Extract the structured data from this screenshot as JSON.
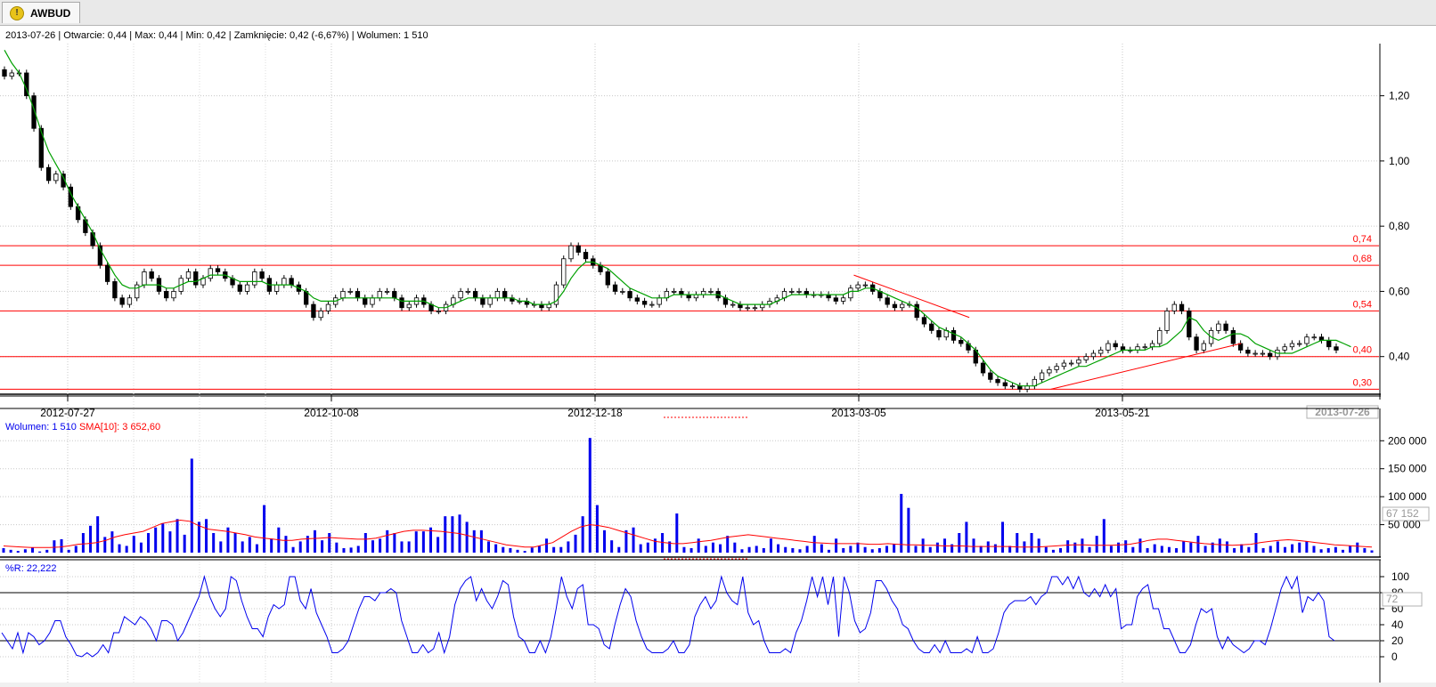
{
  "tab": {
    "label": "AWBUD",
    "icon": "warning-icon"
  },
  "header": {
    "date": "2013-07-26",
    "open": "Otwarcie: 0,44",
    "max": "Max: 0,44",
    "min": "Min: 0,42",
    "close": "Zamknięcie: 0,42 (-6,67%)",
    "volume": "Wolumen: 1 510"
  },
  "volume_legend": {
    "wolumen": "Wolumen: 1 510",
    "sma": "SMA[10]: 3 652,60"
  },
  "willr_legend": {
    "label": "%R: 22,222"
  },
  "colors": {
    "price_line": "#00a000",
    "levels": "#ff0000",
    "volume_bar": "#0000ee",
    "sma": "#ff0000",
    "willr": "#0000ee",
    "grid": "#c8c8c8"
  },
  "chart_data": [
    {
      "type": "candlestick",
      "yticks": [
        "1,20",
        "1,00",
        "0,80",
        "0,60",
        "0,40"
      ],
      "ytick_values": [
        1.2,
        1.0,
        0.8,
        0.6,
        0.4
      ],
      "xticks": [
        "2012-07-27",
        "2012-10-08",
        "2012-12-18",
        "2013-03-05",
        "2013-05-21"
      ],
      "current_date_label": "2013-07-26",
      "ylim": [
        0.29,
        1.36
      ],
      "levels": [
        {
          "label": "0,74",
          "value": 0.74
        },
        {
          "label": "0,68",
          "value": 0.68
        },
        {
          "label": "0,54",
          "value": 0.54
        },
        {
          "label": "0,40",
          "value": 0.4
        },
        {
          "label": "0,30",
          "value": 0.3
        }
      ],
      "trendlines": [
        {
          "from": [
            "2013-03-15",
            0.65
          ],
          "to": [
            "2013-04-20",
            0.52
          ]
        },
        {
          "from": [
            "2013-05-08",
            0.3
          ],
          "to": [
            "2013-06-27",
            0.44
          ]
        }
      ],
      "close_series": [
        1.26,
        1.27,
        1.27,
        1.2,
        1.1,
        0.98,
        0.94,
        0.96,
        0.92,
        0.86,
        0.82,
        0.78,
        0.74,
        0.68,
        0.63,
        0.58,
        0.56,
        0.58,
        0.62,
        0.66,
        0.64,
        0.6,
        0.58,
        0.6,
        0.64,
        0.66,
        0.62,
        0.64,
        0.67,
        0.66,
        0.64,
        0.62,
        0.6,
        0.62,
        0.66,
        0.64,
        0.6,
        0.62,
        0.64,
        0.62,
        0.6,
        0.56,
        0.52,
        0.54,
        0.56,
        0.58,
        0.6,
        0.6,
        0.58,
        0.56,
        0.58,
        0.6,
        0.6,
        0.58,
        0.55,
        0.56,
        0.58,
        0.56,
        0.54,
        0.54,
        0.56,
        0.58,
        0.6,
        0.6,
        0.58,
        0.56,
        0.58,
        0.6,
        0.58,
        0.57,
        0.57,
        0.56,
        0.56,
        0.55,
        0.56,
        0.62,
        0.7,
        0.74,
        0.72,
        0.7,
        0.68,
        0.66,
        0.62,
        0.6,
        0.6,
        0.58,
        0.57,
        0.56,
        0.56,
        0.58,
        0.6,
        0.6,
        0.59,
        0.58,
        0.59,
        0.6,
        0.6,
        0.58,
        0.56,
        0.56,
        0.55,
        0.55,
        0.55,
        0.56,
        0.57,
        0.58,
        0.6,
        0.6,
        0.6,
        0.59,
        0.59,
        0.59,
        0.58,
        0.57,
        0.58,
        0.61,
        0.62,
        0.62,
        0.6,
        0.58,
        0.56,
        0.55,
        0.56,
        0.56,
        0.52,
        0.5,
        0.48,
        0.46,
        0.48,
        0.45,
        0.44,
        0.42,
        0.38,
        0.35,
        0.33,
        0.32,
        0.31,
        0.31,
        0.3,
        0.31,
        0.33,
        0.35,
        0.36,
        0.37,
        0.38,
        0.38,
        0.39,
        0.4,
        0.41,
        0.42,
        0.44,
        0.43,
        0.42,
        0.42,
        0.43,
        0.43,
        0.44,
        0.48,
        0.54,
        0.56,
        0.54,
        0.46,
        0.42,
        0.44,
        0.48,
        0.5,
        0.48,
        0.44,
        0.42,
        0.41,
        0.41,
        0.41,
        0.4,
        0.42,
        0.43,
        0.44,
        0.44,
        0.46,
        0.46,
        0.45,
        0.43,
        0.42
      ],
      "sma_series": [
        1.34,
        1.3,
        1.27,
        1.22,
        1.16,
        1.09,
        1.03,
        0.99,
        0.95,
        0.9,
        0.86,
        0.82,
        0.78,
        0.73,
        0.69,
        0.65,
        0.62,
        0.61,
        0.61,
        0.62,
        0.62,
        0.62,
        0.61,
        0.61,
        0.62,
        0.63,
        0.63,
        0.64,
        0.65,
        0.65,
        0.65,
        0.64,
        0.63,
        0.63,
        0.63,
        0.63,
        0.62,
        0.62,
        0.62,
        0.62,
        0.61,
        0.6,
        0.58,
        0.57,
        0.57,
        0.57,
        0.58,
        0.58,
        0.58,
        0.58,
        0.58,
        0.58,
        0.58,
        0.58,
        0.57,
        0.57,
        0.57,
        0.57,
        0.56,
        0.55,
        0.55,
        0.56,
        0.57,
        0.58,
        0.58,
        0.58,
        0.58,
        0.58,
        0.58,
        0.58,
        0.57,
        0.57,
        0.56,
        0.56,
        0.56,
        0.57,
        0.6,
        0.64,
        0.67,
        0.69,
        0.69,
        0.68,
        0.67,
        0.65,
        0.63,
        0.61,
        0.6,
        0.59,
        0.58,
        0.58,
        0.58,
        0.59,
        0.59,
        0.59,
        0.59,
        0.59,
        0.59,
        0.59,
        0.58,
        0.57,
        0.56,
        0.56,
        0.56,
        0.56,
        0.56,
        0.57,
        0.58,
        0.59,
        0.59,
        0.59,
        0.59,
        0.59,
        0.59,
        0.59,
        0.59,
        0.6,
        0.6,
        0.61,
        0.61,
        0.6,
        0.59,
        0.58,
        0.57,
        0.56,
        0.55,
        0.53,
        0.51,
        0.49,
        0.48,
        0.47,
        0.46,
        0.44,
        0.42,
        0.39,
        0.36,
        0.34,
        0.33,
        0.32,
        0.31,
        0.31,
        0.31,
        0.32,
        0.33,
        0.34,
        0.35,
        0.36,
        0.37,
        0.37,
        0.38,
        0.39,
        0.4,
        0.41,
        0.42,
        0.42,
        0.42,
        0.42,
        0.43,
        0.43,
        0.44,
        0.46,
        0.48,
        0.52,
        0.51,
        0.48,
        0.46,
        0.45,
        0.46,
        0.47,
        0.47,
        0.46,
        0.44,
        0.43,
        0.42,
        0.41,
        0.41,
        0.41,
        0.42,
        0.43,
        0.44,
        0.45,
        0.45,
        0.45,
        0.44,
        0.43
      ]
    },
    {
      "type": "bar",
      "name": "Wolumen",
      "yticks": [
        "200 000",
        "150 000",
        "100 000",
        "50 000"
      ],
      "ytick_values": [
        200000,
        150000,
        100000,
        50000
      ],
      "current_value_label": "67 152",
      "ylim": [
        0,
        210000
      ],
      "values": [
        8000,
        5000,
        3000,
        6000,
        9000,
        2000,
        5000,
        22000,
        24000,
        5000,
        12000,
        35000,
        48000,
        65000,
        28000,
        38000,
        15000,
        12000,
        30000,
        18000,
        35000,
        45000,
        52000,
        38000,
        60000,
        32000,
        168000,
        55000,
        60000,
        35000,
        20000,
        45000,
        35000,
        20000,
        28000,
        15000,
        85000,
        25000,
        45000,
        30000,
        10000,
        20000,
        30000,
        40000,
        22000,
        35000,
        18000,
        8000,
        9000,
        12000,
        35000,
        22000,
        25000,
        40000,
        35000,
        20000,
        20000,
        38000,
        38000,
        45000,
        28000,
        65000,
        65000,
        68000,
        55000,
        40000,
        40000,
        20000,
        15000,
        10000,
        8000,
        5000,
        3000,
        9000,
        12000,
        25000,
        10000,
        10000,
        20000,
        32000,
        65000,
        205000,
        85000,
        40000,
        22000,
        10000,
        40000,
        45000,
        15000,
        18000,
        25000,
        35000,
        20000,
        70000,
        10000,
        8000,
        25000,
        12000,
        18000,
        15000,
        30000,
        18000,
        6000,
        10000,
        12000,
        8000,
        25000,
        15000,
        10000,
        8000,
        6000,
        12000,
        30000,
        15000,
        5000,
        25000,
        8000,
        12000,
        18000,
        10000,
        6000,
        8000,
        12000,
        15000,
        105000,
        80000,
        12000,
        25000,
        10000,
        18000,
        25000,
        15000,
        35000,
        55000,
        25000,
        12000,
        20000,
        15000,
        55000,
        12000,
        35000,
        20000,
        35000,
        25000,
        10000,
        5000,
        8000,
        22000,
        18000,
        25000,
        10000,
        30000,
        60000,
        12000,
        18000,
        22000,
        10000,
        25000,
        8000,
        15000,
        12000,
        10000,
        8000,
        20000,
        18000,
        30000,
        12000,
        18000,
        25000,
        20000,
        8000,
        15000,
        10000,
        35000,
        8000,
        12000,
        20000,
        10000,
        15000,
        18000,
        20000,
        12000,
        6000,
        8000,
        10000,
        5000,
        12000,
        18000,
        8000,
        4000
      ],
      "sma_values": [
        12000,
        11000,
        10000,
        9000,
        9000,
        9000,
        10000,
        12000,
        15000,
        16000,
        18000,
        22000,
        28000,
        32000,
        35000,
        38000,
        45000,
        52000,
        55000,
        58000,
        56000,
        48000,
        42000,
        40000,
        38000,
        35000,
        32000,
        28000,
        26000,
        24000,
        22000,
        22000,
        24000,
        25000,
        26000,
        27000,
        26000,
        25000,
        24000,
        24000,
        26000,
        30000,
        34000,
        38000,
        40000,
        40000,
        39000,
        38000,
        36000,
        34000,
        30000,
        26000,
        22000,
        18000,
        14000,
        12000,
        10000,
        10000,
        14000,
        18000,
        28000,
        38000,
        46000,
        50000,
        48000,
        45000,
        40000,
        35000,
        30000,
        25000,
        20000,
        18000,
        16000,
        16000,
        18000,
        20000,
        22000,
        25000,
        28000,
        30000,
        32000,
        30000,
        28000,
        26000,
        24000,
        22000,
        20000,
        18000,
        17000,
        16000,
        16000,
        16000,
        16000,
        15000,
        15000,
        16000,
        15000,
        14000,
        14000,
        13000,
        13000,
        12000,
        12000,
        12000,
        11000,
        11000,
        11000,
        11000,
        11000,
        10000,
        10000,
        10000,
        11000,
        12000,
        13000,
        14000,
        14000,
        13000,
        13000,
        13000,
        14000,
        15000,
        18000,
        22000,
        24000,
        24000,
        22000,
        20000,
        18000,
        16000,
        15000,
        14000,
        13000,
        14000,
        15000,
        18000,
        20000,
        22000,
        23000,
        22000,
        20000,
        18000,
        16000,
        14000,
        13000,
        12000,
        11000,
        10000
      ]
    },
    {
      "type": "line",
      "name": "%R",
      "yticks": [
        "100",
        "80",
        "60",
        "40",
        "20",
        "0"
      ],
      "ytick_values": [
        100,
        80,
        60,
        40,
        20,
        0
      ],
      "current_value_label": "72",
      "thresholds": [
        80,
        20
      ],
      "ylim": [
        0,
        100
      ],
      "values": [
        30,
        20,
        10,
        30,
        5,
        30,
        25,
        15,
        20,
        30,
        45,
        45,
        25,
        15,
        2,
        0,
        5,
        0,
        5,
        15,
        5,
        30,
        30,
        50,
        45,
        40,
        50,
        45,
        35,
        20,
        45,
        45,
        40,
        20,
        30,
        45,
        60,
        75,
        100,
        75,
        60,
        50,
        60,
        100,
        95,
        70,
        50,
        35,
        35,
        25,
        50,
        65,
        60,
        65,
        100,
        100,
        70,
        60,
        85,
        55,
        40,
        25,
        5,
        5,
        10,
        20,
        40,
        60,
        75,
        75,
        70,
        80,
        80,
        85,
        80,
        45,
        25,
        5,
        5,
        15,
        5,
        10,
        30,
        5,
        25,
        65,
        85,
        95,
        100,
        70,
        85,
        70,
        60,
        75,
        95,
        90,
        50,
        25,
        20,
        5,
        5,
        20,
        5,
        25,
        60,
        100,
        75,
        60,
        85,
        90,
        40,
        40,
        35,
        15,
        10,
        40,
        65,
        85,
        75,
        45,
        25,
        10,
        5,
        5,
        5,
        10,
        20,
        5,
        5,
        15,
        50,
        65,
        75,
        60,
        70,
        100,
        80,
        70,
        65,
        100,
        55,
        40,
        45,
        20,
        5,
        5,
        5,
        10,
        5,
        30,
        45,
        70,
        100,
        75,
        100,
        65,
        100,
        25,
        100,
        80,
        45,
        30,
        35,
        55,
        95,
        95,
        85,
        70,
        60,
        40,
        35,
        20,
        10,
        5,
        5,
        15,
        5,
        20,
        5,
        5,
        5,
        10,
        5,
        25,
        5,
        5,
        10,
        30,
        55,
        65,
        70,
        70,
        70,
        75,
        65,
        75,
        80,
        100,
        100,
        90,
        100,
        85,
        100,
        80,
        75,
        85,
        75,
        90,
        75,
        85,
        35,
        40,
        40,
        75,
        85,
        90,
        60,
        60,
        35,
        35,
        20,
        5,
        5,
        15,
        40,
        60,
        55,
        60,
        25,
        10,
        25,
        15,
        10,
        5,
        10,
        20,
        20,
        15,
        35,
        60,
        85,
        100,
        85,
        100,
        55,
        75,
        70,
        80,
        70,
        25,
        20
      ]
    }
  ]
}
